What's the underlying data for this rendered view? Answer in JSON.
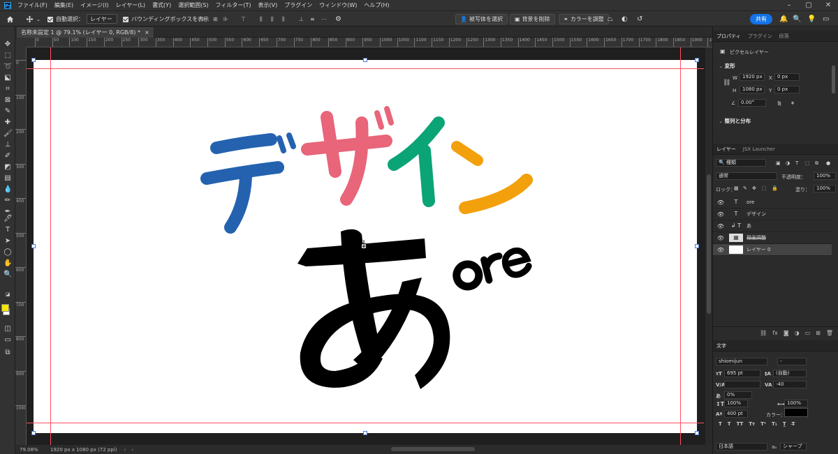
{
  "app": {
    "logo": "Ps"
  },
  "menubar": {
    "items": [
      "ファイル(F)",
      "編集(E)",
      "イメージ(I)",
      "レイヤー(L)",
      "書式(Y)",
      "選択範囲(S)",
      "フィルター(T)",
      "表示(V)",
      "プラグイン",
      "ウィンドウ(W)",
      "ヘルプ(H)"
    ]
  },
  "options": {
    "auto_select_label": "自動選択：",
    "auto_select_value": "レイヤー",
    "bounding_box_label": "バウンディングボックスを表示",
    "select_subject": "被写体を選択",
    "remove_background": "背景を削除",
    "adjust_color": "カラーを調整",
    "share": "共有"
  },
  "document_tab": {
    "label": "名称未設定 1 @ 79.1% (レイヤー 0, RGB/8) *",
    "close": "×"
  },
  "ruler_top": [
    "0",
    "50",
    "100",
    "150",
    "200",
    "250",
    "300",
    "350",
    "400",
    "450",
    "500",
    "550",
    "600",
    "650",
    "700",
    "750",
    "800",
    "850",
    "900",
    "950",
    "1000",
    "1050",
    "1100",
    "1150",
    "1200",
    "1250",
    "1300",
    "1350",
    "1400",
    "1450",
    "1500",
    "1550",
    "1600",
    "1650",
    "1700",
    "1750",
    "1800",
    "1850",
    "1900",
    "1950"
  ],
  "ruler_left": [
    "0",
    "100",
    "200",
    "300",
    "400",
    "500",
    "600",
    "700",
    "800",
    "900",
    "1000"
  ],
  "canvas_text": {
    "design": [
      "デ",
      "ザ",
      "イ",
      "ン"
    ],
    "design_colors": [
      "#2462b0",
      "#e8657a",
      "#0ba477",
      "#f3a00d"
    ],
    "a": "あ",
    "ore": "ore"
  },
  "status": {
    "zoom": "79.08%",
    "info": "1920 px x 1080 px (72 ppi)"
  },
  "properties": {
    "tabs": [
      "プロパティ",
      "プラグイン",
      "段落"
    ],
    "kind": "ピクセルレイヤー",
    "transform_title": "変形",
    "w_label": "W",
    "w": "1920 px",
    "x_label": "X",
    "x": "0 px",
    "h_label": "H",
    "h": "1080 px",
    "y_label": "Y",
    "y": "0 px",
    "angle": "0.00°",
    "align_title": "整列と分布"
  },
  "layers": {
    "tabs": [
      "レイヤー",
      "JSX Launcher"
    ],
    "filter": "種類",
    "blend": "通常",
    "opacity_label": "不透明度：",
    "opacity": "100%",
    "lock_label": "ロック：",
    "fill_label": "塗り：",
    "fill": "100%",
    "items": [
      {
        "name": "ore",
        "type": "T",
        "selected": false
      },
      {
        "name": "デザイン",
        "type": "T",
        "selected": false
      },
      {
        "name": "あ",
        "type": "T",
        "selected": false
      },
      {
        "name": "描画調整",
        "type": "adj",
        "selected": false
      },
      {
        "name": "レイヤー 0",
        "type": "pixel",
        "selected": true
      }
    ]
  },
  "character": {
    "tab": "文字",
    "font": "shiomijun",
    "style": "-",
    "size": "695 pt",
    "leading": "(自動)",
    "kerning": "",
    "tracking": "-40",
    "tsume": "0%",
    "vscale": "100%",
    "hscale": "100%",
    "baseline": "400 pt",
    "color_label": "カラー：",
    "color": "#000000",
    "language": "日本語",
    "aa": "シャープ"
  }
}
